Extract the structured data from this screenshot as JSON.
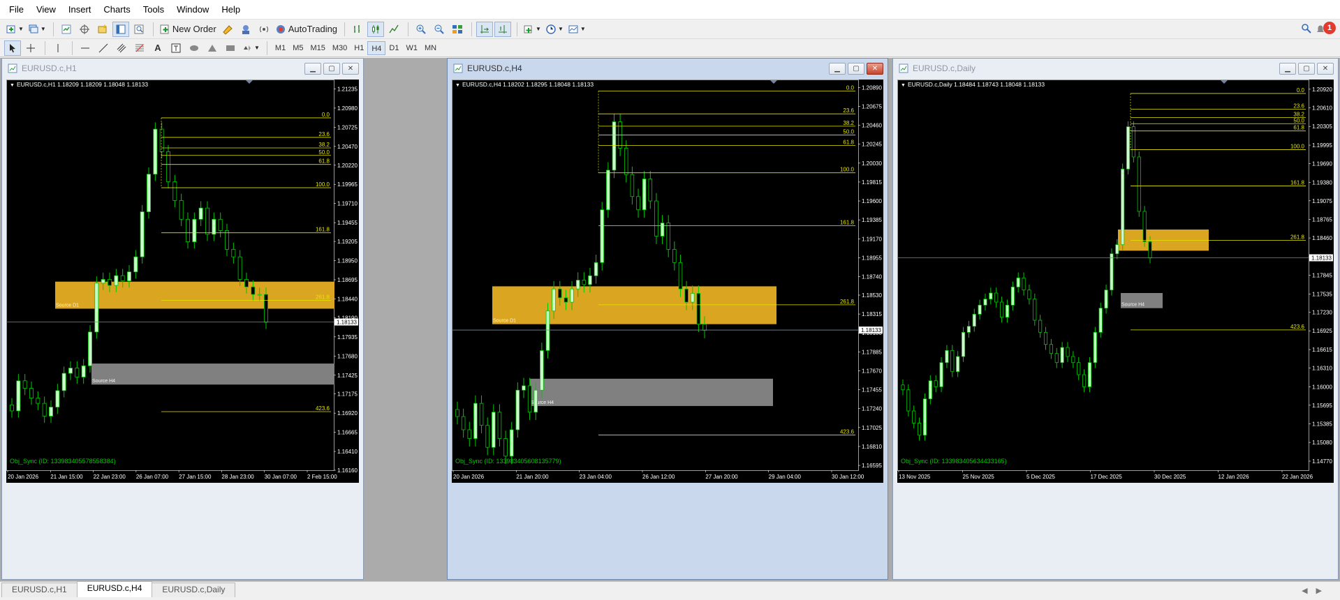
{
  "menu": [
    "File",
    "View",
    "Insert",
    "Charts",
    "Tools",
    "Window",
    "Help"
  ],
  "toolbar": {
    "new_order": "New Order",
    "autotrading": "AutoTrading",
    "alert_count": "1",
    "timeframes": [
      "M1",
      "M5",
      "M15",
      "M30",
      "H1",
      "H4",
      "D1",
      "W1",
      "MN"
    ],
    "active_timeframe": "H4"
  },
  "tabs": [
    "EURUSD.c,H1",
    "EURUSD.c,H4",
    "EURUSD.c,Daily"
  ],
  "active_tab": 1,
  "colors": {
    "chart_bg": "#000000",
    "candle": "#00c800",
    "bull_body": "#c8ffc8",
    "fibo": "#e5e500",
    "zone_d1": "#daa520",
    "zone_h4": "#808080",
    "price_line": "#778899",
    "obj_sync": "#00c800"
  },
  "chart_data": [
    {
      "type": "candlestick",
      "window_title": "EURUSD.c,H1",
      "header": "EURUSD.c,H1  1.18209 1.18209 1.18048 1.18133",
      "current_price": "1.18133",
      "y_ticks": [
        "1.21235",
        "1.20980",
        "1.20725",
        "1.20470",
        "1.20220",
        "1.19965",
        "1.19710",
        "1.19455",
        "1.19205",
        "1.18950",
        "1.18695",
        "1.18440",
        "1.18190",
        "1.17935",
        "1.17680",
        "1.17425",
        "1.17175",
        "1.16920",
        "1.16665",
        "1.16410",
        "1.16160"
      ],
      "x_ticks": [
        "20 Jan 2026",
        "21 Jan 15:00",
        "22 Jan 23:00",
        "26 Jan 07:00",
        "27 Jan 15:00",
        "28 Jan 23:00",
        "30 Jan 07:00",
        "2 Feb 15:00"
      ],
      "ylim": [
        1.1616,
        1.2136
      ],
      "fibo": {
        "levels": [
          "0.0",
          "23.6",
          "38.2",
          "50.0",
          "61.8",
          "100.0",
          "161.8",
          "261.8",
          "423.6"
        ],
        "prices": [
          1.2085,
          1.2059,
          1.2045,
          1.2035,
          1.2023,
          1.1992,
          1.1932,
          1.1842,
          1.1694
        ]
      },
      "zones": [
        {
          "label": "Source D1",
          "type": "d1",
          "top": 1.1867,
          "bottom": 1.1831
        },
        {
          "label": "Source H4",
          "type": "h4",
          "top": 1.1758,
          "bottom": 1.173
        }
      ],
      "obj_label": "Obj_Sync (ID: 133983405578558384)",
      "closes": [
        1.1695,
        1.1735,
        1.1725,
        1.1712,
        1.1705,
        1.1688,
        1.17,
        1.1722,
        1.1745,
        1.1752,
        1.174,
        1.1755,
        1.18,
        1.1865,
        1.187,
        1.1862,
        1.1875,
        1.1868,
        1.188,
        1.19,
        1.196,
        1.201,
        1.207,
        1.204,
        1.2,
        1.1975,
        1.195,
        1.192,
        1.195,
        1.1965,
        1.193,
        1.195,
        1.1935,
        1.191,
        1.19,
        1.187,
        1.186,
        1.185,
        1.185,
        1.1813
      ]
    },
    {
      "type": "candlestick",
      "window_title": "EURUSD.c,H4",
      "header": "EURUSD.c,H4  1.18202 1.18295 1.18048 1.18133",
      "current_price": "1.18133",
      "y_ticks": [
        "1.20890",
        "1.20675",
        "1.20460",
        "1.20245",
        "1.20030",
        "1.19815",
        "1.19600",
        "1.19385",
        "1.19170",
        "1.18955",
        "1.18740",
        "1.18530",
        "1.18315",
        "1.18100",
        "1.17885",
        "1.17670",
        "1.17455",
        "1.17240",
        "1.17025",
        "1.16810",
        "1.16595"
      ],
      "x_ticks": [
        "20 Jan 2026",
        "21 Jan 20:00",
        "23 Jan 04:00",
        "26 Jan 12:00",
        "27 Jan 20:00",
        "29 Jan 04:00",
        "30 Jan 12:00"
      ],
      "ylim": [
        1.1654,
        1.2098
      ],
      "fibo": {
        "levels": [
          "0.0",
          "23.6",
          "38.2",
          "50.0",
          "61.8",
          "100.0",
          "161.8",
          "261.8",
          "423.6"
        ],
        "prices": [
          1.2085,
          1.2059,
          1.2045,
          1.2035,
          1.2023,
          1.1992,
          1.1932,
          1.1842,
          1.1694
        ]
      },
      "zones": [
        {
          "label": "Source D1",
          "type": "d1",
          "top": 1.1863,
          "bottom": 1.182
        },
        {
          "label": "Source H4",
          "type": "h4",
          "top": 1.1758,
          "bottom": 1.1727
        }
      ],
      "obj_label": "Obj_Sync (ID: 133983405608135779)",
      "closes": [
        1.1715,
        1.17,
        1.169,
        1.173,
        1.1705,
        1.168,
        1.172,
        1.169,
        1.167,
        1.17,
        1.1745,
        1.175,
        1.172,
        1.1745,
        1.179,
        1.1835,
        1.186,
        1.185,
        1.1845,
        1.186,
        1.187,
        1.1865,
        1.1875,
        1.189,
        1.195,
        1.1995,
        1.205,
        1.202,
        1.199,
        1.1965,
        1.195,
        1.1985,
        1.196,
        1.192,
        1.1935,
        1.1905,
        1.189,
        1.186,
        1.1845,
        1.1855,
        1.182,
        1.1813
      ]
    },
    {
      "type": "candlestick",
      "window_title": "EURUSD.c,Daily",
      "header": "EURUSD.c,Daily  1.18484 1.18743 1.18048 1.18133",
      "current_price": "1.18133",
      "y_ticks": [
        "1.20920",
        "1.20610",
        "1.20305",
        "1.19995",
        "1.19690",
        "1.19380",
        "1.19075",
        "1.18765",
        "1.18460",
        "1.18150",
        "1.17845",
        "1.17535",
        "1.17230",
        "1.16925",
        "1.16615",
        "1.16310",
        "1.16000",
        "1.15695",
        "1.15385",
        "1.15080",
        "1.14770"
      ],
      "x_ticks": [
        "13 Nov 2025",
        "25 Nov 2025",
        "5 Dec 2025",
        "17 Dec 2025",
        "30 Dec 2025",
        "12 Jan 2026",
        "22 Jan 2026"
      ],
      "ylim": [
        1.1462,
        1.2108
      ],
      "fibo": {
        "levels": [
          "0.0",
          "23.6",
          "38.2",
          "50.0",
          "61.8",
          "100.0",
          "161.8",
          "261.8",
          "423.6"
        ],
        "prices": [
          1.2085,
          1.2059,
          1.2045,
          1.2035,
          1.2023,
          1.1992,
          1.1932,
          1.1842,
          1.1694
        ]
      },
      "zones": [
        {
          "label": "",
          "type": "d1",
          "top": 1.186,
          "bottom": 1.1825
        },
        {
          "label": "Source H4",
          "type": "h4",
          "top": 1.1755,
          "bottom": 1.173
        }
      ],
      "obj_label": "Obj_Sync (ID: 133983405634433165)",
      "closes": [
        1.1595,
        1.156,
        1.154,
        1.152,
        1.158,
        1.161,
        1.16,
        1.164,
        1.166,
        1.1625,
        1.165,
        1.169,
        1.17,
        1.172,
        1.1735,
        1.1745,
        1.1755,
        1.174,
        1.1715,
        1.1735,
        1.1765,
        1.178,
        1.176,
        1.1745,
        1.171,
        1.169,
        1.167,
        1.1655,
        1.164,
        1.1665,
        1.165,
        1.164,
        1.162,
        1.16,
        1.164,
        1.169,
        1.173,
        1.176,
        1.182,
        1.1835,
        1.196,
        1.203,
        1.198,
        1.189,
        1.184,
        1.1813
      ]
    }
  ]
}
